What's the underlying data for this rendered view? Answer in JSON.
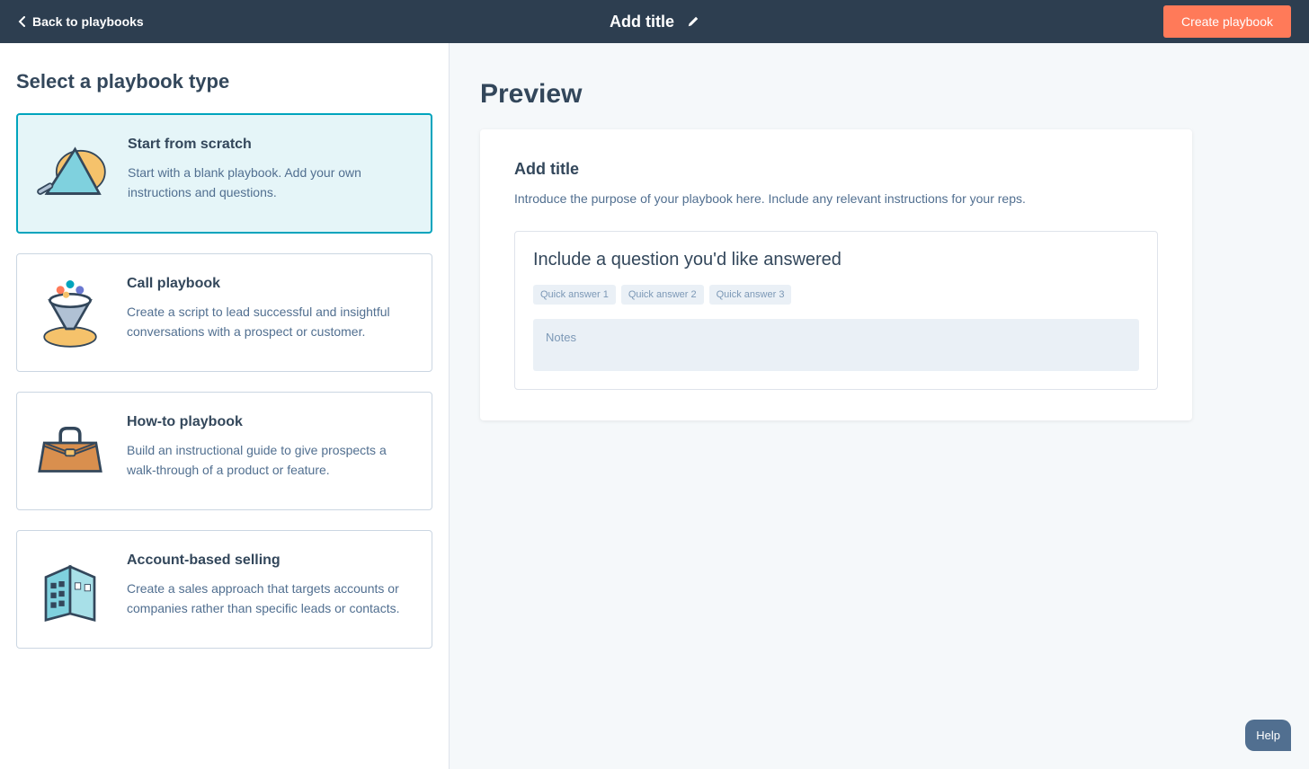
{
  "header": {
    "back_label": "Back to playbooks",
    "title": "Add title",
    "create_label": "Create playbook"
  },
  "left": {
    "section_title": "Select a playbook type",
    "cards": [
      {
        "title": "Start from scratch",
        "desc": "Start with a blank playbook. Add your own instructions and questions."
      },
      {
        "title": "Call playbook",
        "desc": "Create a script to lead successful and insightful conversations with a prospect or customer."
      },
      {
        "title": "How-to playbook",
        "desc": "Build an instructional guide to give prospects a walk-through of a product or feature."
      },
      {
        "title": "Account-based selling",
        "desc": "Create a sales approach that targets accounts or companies rather than specific leads or contacts."
      }
    ]
  },
  "preview": {
    "title": "Preview",
    "heading": "Add title",
    "intro": "Introduce the purpose of your playbook here. Include any relevant instructions for your reps.",
    "question": "Include a question you'd like answered",
    "chips": [
      "Quick answer 1",
      "Quick answer 2",
      "Quick answer 3"
    ],
    "notes_label": "Notes"
  },
  "help_label": "Help"
}
